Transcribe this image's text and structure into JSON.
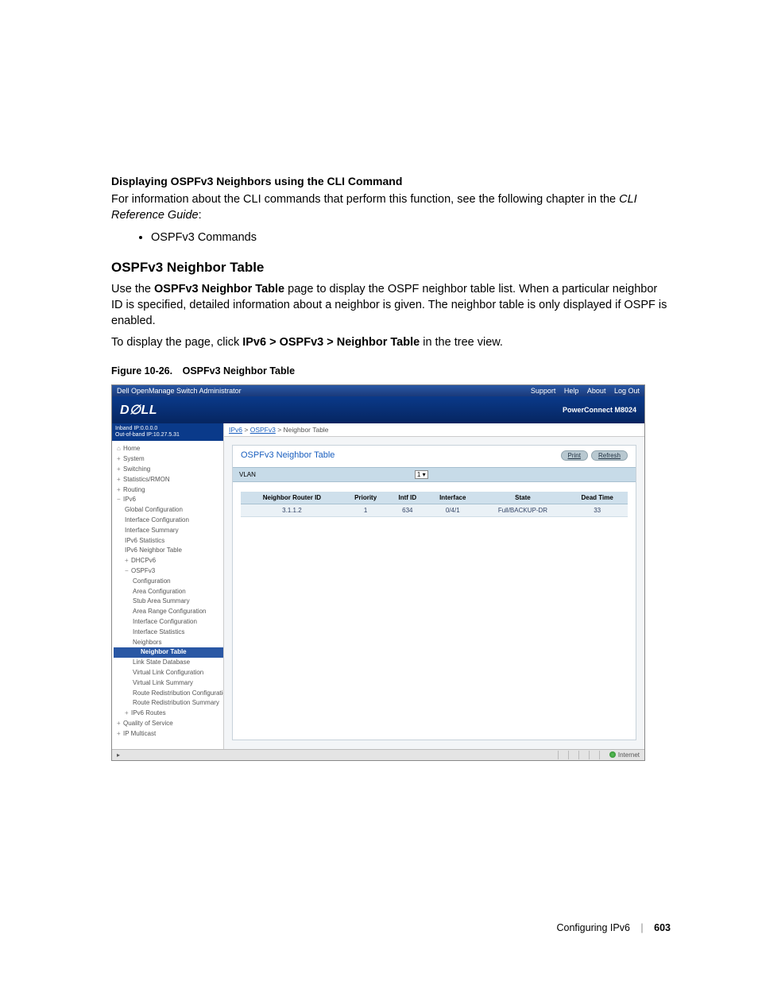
{
  "doc": {
    "h1": "Displaying OSPFv3 Neighbors using the CLI Command",
    "p1a": "For information about the CLI commands that perform this function, see the following chapter in the ",
    "p1b": "CLI Reference Guide",
    "p1c": ":",
    "bullet1": "OSPFv3 Commands",
    "h2": "OSPFv3 Neighbor Table",
    "p2a": "Use the ",
    "p2b": "OSPFv3 Neighbor Table",
    "p2c": " page to display the OSPF neighbor table list. When a particular neighbor ID is specified, detailed information about a neighbor is given. The neighbor table is only displayed if OSPF is enabled.",
    "p3a": "To display the page, click ",
    "p3b": "IPv6 > OSPFv3 > Neighbor Table",
    "p3c": " in the tree view.",
    "figcap": "Figure 10-26. OSPFv3 Neighbor Table"
  },
  "ss": {
    "titlebar": "Dell OpenManage Switch Administrator",
    "topLinks": {
      "support": "Support",
      "help": "Help",
      "about": "About",
      "logout": "Log Out"
    },
    "logo": "D∅LL",
    "product": "PowerConnect M8024",
    "ip1": "Inband IP:0.0.0.0",
    "ip2": "Out-of-band IP:10.27.5.31",
    "breadcrumb": {
      "a1": "IPv6",
      "a2": "OSPFv3",
      "tail": " > Neighbor Table"
    },
    "tree": {
      "home": "Home",
      "system": "System",
      "switching": "Switching",
      "statsrmon": "Statistics/RMON",
      "routing": "Routing",
      "ipv6": "IPv6",
      "globalcfg": "Global Configuration",
      "intfcfg": "Interface Configuration",
      "intfsum": "Interface Summary",
      "ipv6stats": "IPv6 Statistics",
      "ipv6neigh": "IPv6 Neighbor Table",
      "dhcpv6": "DHCPv6",
      "ospfv3": "OSPFv3",
      "cfg": "Configuration",
      "areacfg": "Area Configuration",
      "stubarea": "Stub Area Summary",
      "arearange": "Area Range Configuration",
      "intfcfg2": "Interface Configuration",
      "intfstats": "Interface Statistics",
      "neighbors": "Neighbors",
      "neightable": "Neighbor Table",
      "lsdb": "Link State Database",
      "vlinkcfg": "Virtual Link Configuration",
      "vlinksum": "Virtual Link Summary",
      "rredistcfg": "Route Redistribution Configuration",
      "rredistsum": "Route Redistribution Summary",
      "ipv6routes": "IPv6 Routes",
      "qos": "Quality of Service",
      "ipmcast": "IP Multicast"
    },
    "panel": {
      "title": "OSPFv3 Neighbor Table",
      "print": "Print",
      "refresh": "Refresh",
      "filterLabel": "VLAN",
      "filterValue": "1",
      "headers": {
        "router": "Neighbor Router ID",
        "priority": "Priority",
        "intfid": "Intf ID",
        "interface": "Interface",
        "state": "State",
        "deadtime": "Dead Time"
      },
      "row": {
        "router": "3.1.1.2",
        "priority": "1",
        "intfid": "634",
        "interface": "0/4/1",
        "state": "Full/BACKUP-DR",
        "deadtime": "33"
      }
    },
    "status": "Internet"
  },
  "footer": {
    "chapter": "Configuring IPv6",
    "page": "603"
  }
}
